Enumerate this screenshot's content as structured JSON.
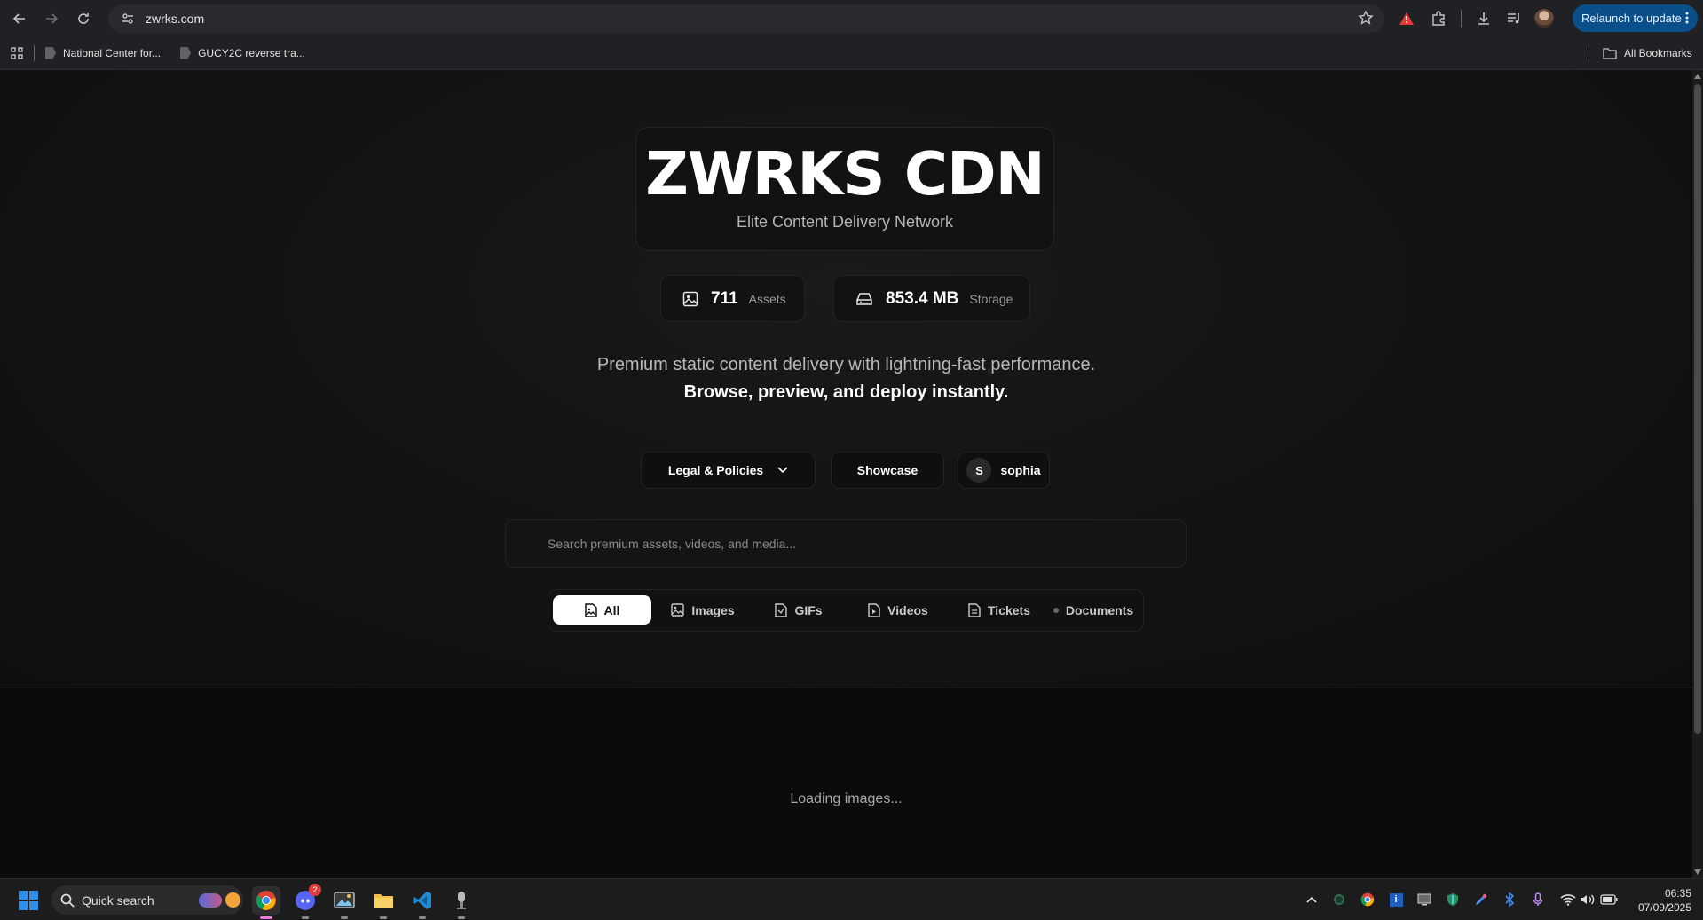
{
  "browser": {
    "url": "zwrks.com",
    "relaunch_label": "Relaunch to update",
    "bookmarks": [
      {
        "label": "National Center for..."
      },
      {
        "label": "GUCY2C reverse tra..."
      }
    ],
    "all_bookmarks_label": "All Bookmarks"
  },
  "page": {
    "title": "ZWRKS CDN",
    "subtitle": "Elite Content Delivery Network",
    "stats": [
      {
        "value": "711",
        "label": "Assets",
        "icon": "image-icon"
      },
      {
        "value": "853.4 MB",
        "label": "Storage",
        "icon": "drive-icon"
      }
    ],
    "tagline_1": "Premium static content delivery with lightning-fast performance.",
    "tagline_2": "Browse, preview, and deploy instantly.",
    "nav": {
      "legal_label": "Legal & Policies",
      "showcase_label": "Showcase",
      "user_initial": "S",
      "user_name": "sophia"
    },
    "search": {
      "placeholder": "Search premium assets, videos, and media..."
    },
    "tabs": [
      {
        "label": "All",
        "active": true
      },
      {
        "label": "Images",
        "active": false
      },
      {
        "label": "GIFs",
        "active": false
      },
      {
        "label": "Videos",
        "active": false
      },
      {
        "label": "Tickets",
        "active": false
      },
      {
        "label": "Documents",
        "active": false
      }
    ],
    "loading_text": "Loading images..."
  },
  "taskbar": {
    "search_label": "Quick search",
    "discord_badge": "2",
    "time": "06:35",
    "date": "07/09/2025"
  },
  "colors": {
    "background": "#0e0e0e",
    "accent_button": "#0b4f8a",
    "active_tab": "#ffffff"
  }
}
